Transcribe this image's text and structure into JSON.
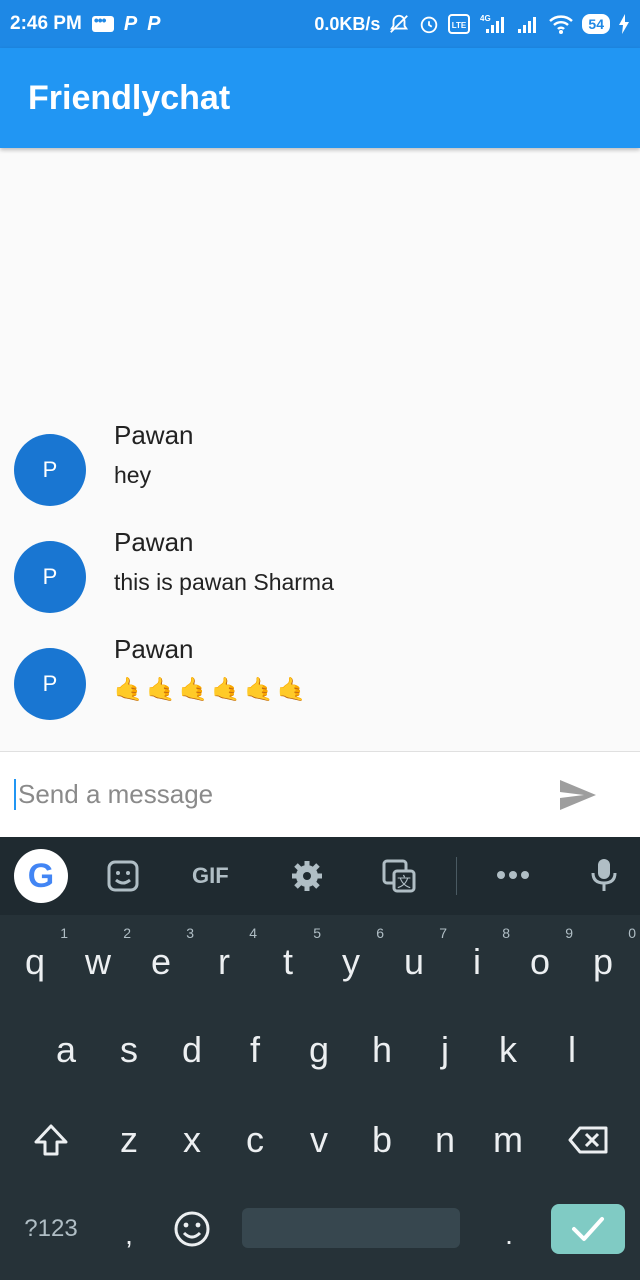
{
  "status_bar": {
    "time": "2:46 PM",
    "left_icons": [
      "message-icon",
      "p-icon",
      "p-icon"
    ],
    "network_speed": "0.0KB/s",
    "right_icons": [
      "bell-off-icon",
      "alarm-icon",
      "volte-icon",
      "signal-4g-icon",
      "signal-icon",
      "wifi-icon"
    ],
    "battery": "54",
    "lte_label": "4G"
  },
  "app_bar": {
    "title": "Friendlychat",
    "color": "#2196f3"
  },
  "messages": [
    {
      "avatar": "P",
      "name": "Pawan",
      "text": "hey"
    },
    {
      "avatar": "P",
      "name": "Pawan",
      "text": "this is pawan Sharma"
    },
    {
      "avatar": "P",
      "name": "Pawan",
      "text": "🤙🤙🤙🤙🤙🤙"
    }
  ],
  "composer": {
    "placeholder": "Send a message",
    "value": "",
    "send_icon": "send-icon"
  },
  "keyboard": {
    "toolbar": {
      "g_label": "G",
      "gif_label": "GIF",
      "icons": [
        "google-icon",
        "sticker-icon",
        "gif-icon",
        "settings-icon",
        "translate-icon",
        "more-icon",
        "mic-icon"
      ]
    },
    "row1": [
      "q",
      "w",
      "e",
      "r",
      "t",
      "y",
      "u",
      "i",
      "o",
      "p"
    ],
    "row1_hints": [
      "1",
      "2",
      "3",
      "4",
      "5",
      "6",
      "7",
      "8",
      "9",
      "0"
    ],
    "row2": [
      "a",
      "s",
      "d",
      "f",
      "g",
      "h",
      "j",
      "k",
      "l"
    ],
    "row3": [
      "z",
      "x",
      "c",
      "v",
      "b",
      "n",
      "m"
    ],
    "symbols_label": "?123",
    "comma": ",",
    "period": ".",
    "accent": "#80cbc4"
  }
}
